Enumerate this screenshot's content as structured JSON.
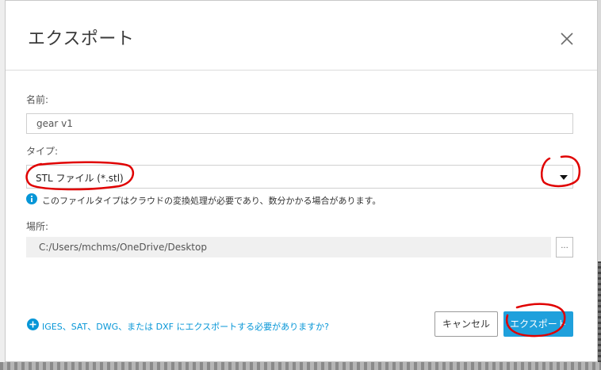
{
  "dialog": {
    "title": "エクスポート",
    "close_icon": "close-icon"
  },
  "name": {
    "label": "名前:",
    "value": "gear v1"
  },
  "type": {
    "label": "タイプ:",
    "selected": "STL ファイル (*.stl)",
    "info_icon": "info-icon",
    "info_text": "このファイルタイプはクラウドの変換処理が必要であり、数分かかる場合があります。"
  },
  "location": {
    "label": "場所:",
    "path": "C:/Users/mchms/OneDrive/Desktop",
    "browse_label": "..."
  },
  "footer": {
    "help_icon": "plus-circle-icon",
    "help_text": "IGES、SAT、DWG、または DXF にエクスポートする必要がありますか?",
    "cancel_label": "キャンセル",
    "export_label": "エクスポート"
  },
  "colors": {
    "accent": "#1fa0dc",
    "link": "#0696d7",
    "annotation": "#e00000"
  }
}
